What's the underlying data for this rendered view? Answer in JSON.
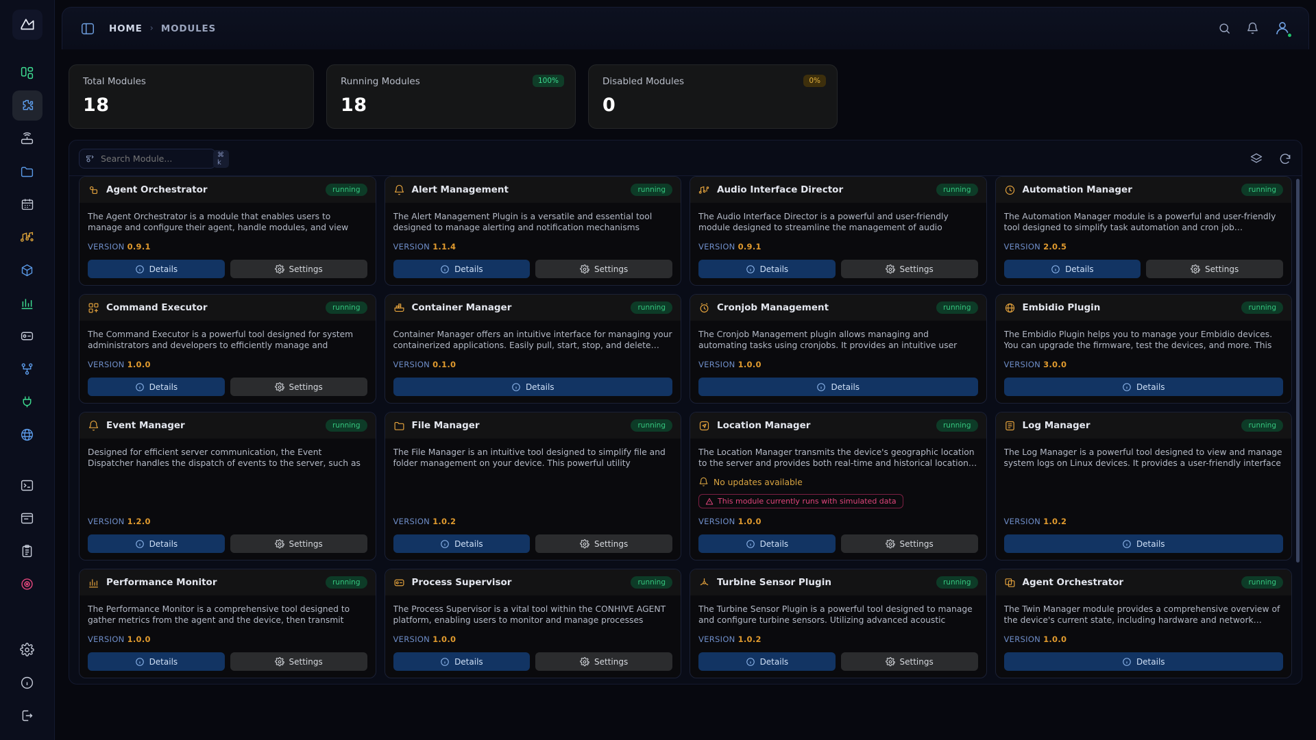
{
  "sidebar": {
    "logo_icon": "app-logo-icon",
    "items": [
      {
        "icon": "dashboard-icon",
        "name": "sidebar-item-dashboard",
        "active": false
      },
      {
        "icon": "puzzle-modules-icon",
        "name": "sidebar-item-modules",
        "active": true
      },
      {
        "icon": "router-icon",
        "name": "sidebar-item-network",
        "active": false
      },
      {
        "icon": "folder-icon",
        "name": "sidebar-item-files",
        "active": false
      },
      {
        "icon": "calendar-icon",
        "name": "sidebar-item-scheduler",
        "active": false
      },
      {
        "icon": "audio-nodes-icon",
        "name": "sidebar-item-audio",
        "active": false
      },
      {
        "icon": "cube-icon",
        "name": "sidebar-item-containers",
        "active": false
      },
      {
        "icon": "bar-chart-icon",
        "name": "sidebar-item-metrics",
        "active": false
      },
      {
        "icon": "process-icon",
        "name": "sidebar-item-processes",
        "active": false
      },
      {
        "icon": "sitemap-icon",
        "name": "sidebar-item-topology",
        "active": false
      },
      {
        "icon": "plug-icon",
        "name": "sidebar-item-integrations",
        "active": false
      },
      {
        "icon": "globe-icon",
        "name": "sidebar-item-location",
        "active": false
      },
      {
        "icon": "terminal-icon",
        "name": "sidebar-item-terminal",
        "active": false
      },
      {
        "icon": "console-icon",
        "name": "sidebar-item-console",
        "active": false
      },
      {
        "icon": "clipboard-icon",
        "name": "sidebar-item-logs",
        "active": false
      },
      {
        "icon": "target-icon",
        "name": "sidebar-item-alerts",
        "active": false
      }
    ],
    "bottom_items": [
      {
        "icon": "gear-icon",
        "name": "sidebar-item-settings"
      },
      {
        "icon": "info-icon",
        "name": "sidebar-item-about"
      },
      {
        "icon": "logout-icon",
        "name": "sidebar-item-logout"
      }
    ]
  },
  "topbar": {
    "panel_toggle_icon": "panel-toggle-icon",
    "breadcrumb": {
      "home": "HOME",
      "separator": "›",
      "current": "MODULES"
    },
    "search_icon": "search-icon",
    "bell_icon": "bell-icon",
    "avatar_icon": "user-avatar-icon"
  },
  "stats": [
    {
      "label": "Total Modules",
      "value": "18",
      "badge": null,
      "badge_style": null
    },
    {
      "label": "Running Modules",
      "value": "18",
      "badge": "100%",
      "badge_style": "green"
    },
    {
      "label": "Disabled Modules",
      "value": "0",
      "badge": "0%",
      "badge_style": "amber"
    }
  ],
  "toolbar": {
    "search_icon": "search-module-icon",
    "search_placeholder": "Search Module...",
    "search_value": "",
    "shortcut": "⌘ k",
    "layers_icon": "layers-icon",
    "refresh_icon": "refresh-icon"
  },
  "labels": {
    "version": "VERSION",
    "details": "Details",
    "settings": "Settings",
    "no_updates": "No updates available",
    "simulated": "This module currently runs with simulated data"
  },
  "modules": [
    {
      "name": "Agent Orchestrator",
      "icon": "agent-orchestrator-icon",
      "status": "running",
      "desc": "The Agent Orchestrator is a module that enables users to manage and configure their agent, handle modules, and view device statu…",
      "version": "0.9.1",
      "has_settings": true,
      "notice": null,
      "simulated": false
    },
    {
      "name": "Alert Management",
      "icon": "alert-management-icon",
      "status": "running",
      "desc": "The Alert Management Plugin is a versatile and essential tool designed to manage alerting and notification mechanisms within…",
      "version": "1.1.4",
      "has_settings": true,
      "notice": null,
      "simulated": false
    },
    {
      "name": "Audio Interface Director",
      "icon": "audio-interface-icon",
      "status": "running",
      "desc": "The Audio Interface Director is a powerful and user-friendly module designed to streamline the management of audio devices. It offe…",
      "version": "0.9.1",
      "has_settings": true,
      "notice": null,
      "simulated": false
    },
    {
      "name": "Automation Manager",
      "icon": "automation-manager-icon",
      "status": "running",
      "desc": "The Automation Manager module is a powerful and user-friendly tool designed to simplify task automation and cron job…",
      "version": "2.0.5",
      "has_settings": true,
      "notice": null,
      "simulated": false
    },
    {
      "name": "Command Executor",
      "icon": "command-executor-icon",
      "status": "running",
      "desc": "The Command Executor is a powerful tool designed for system administrators and developers to efficiently manage and execute…",
      "version": "1.0.0",
      "has_settings": true,
      "notice": null,
      "simulated": false
    },
    {
      "name": "Container Manager",
      "icon": "container-manager-icon",
      "status": "running",
      "desc": "Container Manager offers an intuitive interface for managing your containerized applications. Easily pull, start, stop, and delete…",
      "version": "0.1.0",
      "has_settings": false,
      "notice": null,
      "simulated": false
    },
    {
      "name": "Cronjob Management",
      "icon": "cronjob-management-icon",
      "status": "running",
      "desc": "The Cronjob Management plugin allows managing and automating tasks using cronjobs. It provides an intuitive user interface for…",
      "version": "1.0.0",
      "has_settings": false,
      "notice": null,
      "simulated": false
    },
    {
      "name": "Embidio Plugin",
      "icon": "embidio-plugin-icon",
      "status": "running",
      "desc": "The Embidio Plugin helps you to manage your Embidio devices. You can upgrade the firmware, test the devices, and more. This modu…",
      "version": "3.0.0",
      "has_settings": false,
      "notice": null,
      "simulated": false
    },
    {
      "name": "Event Manager",
      "icon": "event-manager-icon",
      "status": "running",
      "desc": "Designed for efficient server communication, the Event Dispatcher handles the dispatch of events to the server, such as notifications…",
      "version": "1.2.0",
      "has_settings": true,
      "notice": null,
      "simulated": false
    },
    {
      "name": "File Manager",
      "icon": "file-manager-icon",
      "status": "running",
      "desc": "The File Manager is an intuitive tool designed to simplify file and folder management on your device. This powerful utility enables…",
      "version": "1.0.2",
      "has_settings": true,
      "notice": null,
      "simulated": false
    },
    {
      "name": "Location Manager",
      "icon": "location-manager-icon",
      "status": "running",
      "desc": "The Location Manager transmits the device's geographic location to the server and provides both real-time and historical location…",
      "version": "1.0.0",
      "has_settings": true,
      "notice": "No updates available",
      "simulated": true
    },
    {
      "name": "Log Manager",
      "icon": "log-manager-icon",
      "status": "running",
      "desc": "The Log Manager is a powerful tool designed to view and manage system logs on Linux devices. It provides a user-friendly interface …",
      "version": "1.0.2",
      "has_settings": false,
      "notice": null,
      "simulated": false
    },
    {
      "name": "Performance Monitor",
      "icon": "performance-monitor-icon",
      "status": "running",
      "desc": "The Performance Monitor is a comprehensive tool designed to gather metrics from the agent and the device, then transmit the…",
      "version": "1.0.0",
      "has_settings": true,
      "notice": null,
      "simulated": false
    },
    {
      "name": "Process Supervisor",
      "icon": "process-supervisor-icon",
      "status": "running",
      "desc": "The Process Supervisor is a vital tool within the CONHIVE AGENT platform, enabling users to monitor and manage processes runni…",
      "version": "1.0.0",
      "has_settings": true,
      "notice": null,
      "simulated": false
    },
    {
      "name": "Turbine Sensor Plugin",
      "icon": "turbine-sensor-icon",
      "status": "running",
      "desc": "The Turbine Sensor Plugin is a powerful tool designed to manage and configure turbine sensors. Utilizing advanced acoustic signal…",
      "version": "1.0.2",
      "has_settings": true,
      "notice": null,
      "simulated": false
    },
    {
      "name": "Agent Orchestrator",
      "icon": "twin-manager-icon",
      "status": "running",
      "desc": "The Twin Manager module provides a comprehensive overview of the device's current state, including hardware and network…",
      "version": "1.0.0",
      "has_settings": false,
      "notice": null,
      "simulated": false
    }
  ]
}
